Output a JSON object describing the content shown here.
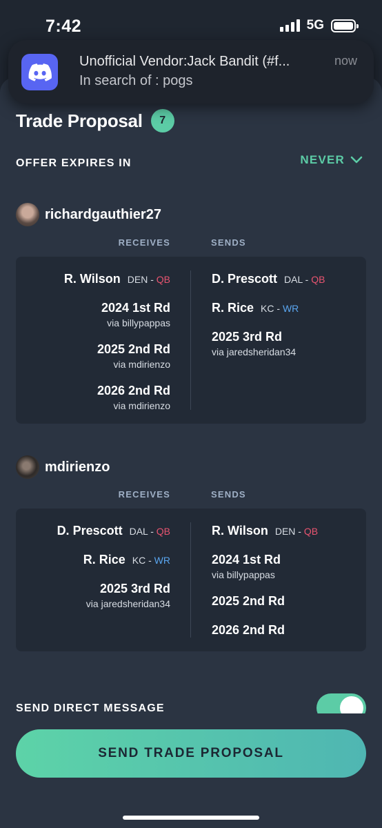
{
  "status_bar": {
    "time": "7:42",
    "network": "5G"
  },
  "notification": {
    "title": "Unofficial Vendor:Jack Bandit (#f...",
    "body": "In search of : pogs",
    "time": "now",
    "app_icon": "discord-icon"
  },
  "trade": {
    "title": "Trade Proposal",
    "badge": "7",
    "expires_label": "OFFER EXPIRES IN",
    "expires_value": "NEVER"
  },
  "columns": {
    "receives": "RECEIVES",
    "sends": "SENDS"
  },
  "teams": [
    {
      "name": "richardgauthier27",
      "receives": [
        {
          "name": "R. Wilson",
          "team": "DEN",
          "sep": "-",
          "pos": "QB"
        },
        {
          "name": "2024 1st Rd",
          "via": "via billypappas"
        },
        {
          "name": "2025 2nd Rd",
          "via": "via mdirienzo"
        },
        {
          "name": "2026 2nd Rd",
          "via": "via mdirienzo"
        }
      ],
      "sends": [
        {
          "name": "D. Prescott",
          "team": "DAL",
          "sep": "-",
          "pos": "QB"
        },
        {
          "name": "R. Rice",
          "team": "KC",
          "sep": "-",
          "pos": "WR"
        },
        {
          "name": "2025 3rd Rd",
          "via": "via jaredsheridan34"
        }
      ]
    },
    {
      "name": "mdirienzo",
      "receives": [
        {
          "name": "D. Prescott",
          "team": "DAL",
          "sep": "-",
          "pos": "QB"
        },
        {
          "name": "R. Rice",
          "team": "KC",
          "sep": "-",
          "pos": "WR"
        },
        {
          "name": "2025 3rd Rd",
          "via": "via jaredsheridan34"
        }
      ],
      "sends": [
        {
          "name": "R. Wilson",
          "team": "DEN",
          "sep": "-",
          "pos": "QB"
        },
        {
          "name": "2024 1st Rd",
          "via": "via billypappas"
        },
        {
          "name": "2025 2nd Rd"
        },
        {
          "name": "2026 2nd Rd"
        }
      ]
    }
  ],
  "direct_message": {
    "label": "SEND DIRECT MESSAGE",
    "enabled": true
  },
  "send_button": "SEND TRADE PROPOSAL",
  "colors": {
    "accent": "#5ccca6",
    "qb": "#e85470",
    "wr": "#5aa6f0",
    "discord": "#5865f2"
  }
}
